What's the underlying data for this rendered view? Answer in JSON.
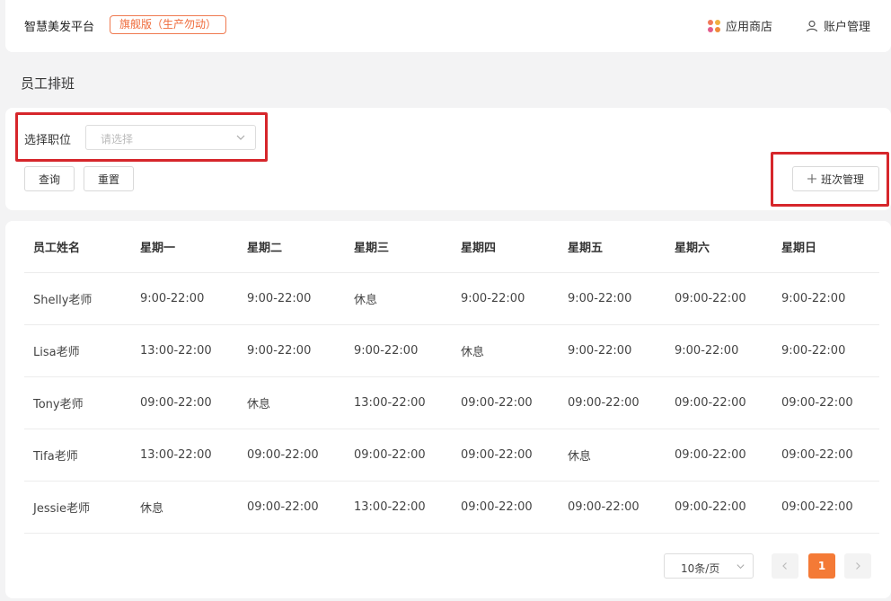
{
  "header": {
    "brand": "智慧美发平台",
    "edition": "旗舰版（生产勿动）",
    "app_store": "应用商店",
    "account": "账户管理",
    "app_store_icon_colors": [
      "#f07a5a",
      "#f0b040",
      "#e25b8c",
      "#f08a3a"
    ]
  },
  "page": {
    "title": "员工排班"
  },
  "filter": {
    "position_label": "选择职位",
    "position_placeholder": "请选择",
    "query_label": "查询",
    "reset_label": "重置",
    "shift_manage_label": "班次管理",
    "shift_manage_icon": "plus-icon"
  },
  "table": {
    "columns": [
      "员工姓名",
      "星期一",
      "星期二",
      "星期三",
      "星期四",
      "星期五",
      "星期六",
      "星期日"
    ],
    "rows": [
      [
        "Shelly老师",
        "9:00-22:00",
        "9:00-22:00",
        "休息",
        "9:00-22:00",
        "9:00-22:00",
        "09:00-22:00",
        "9:00-22:00"
      ],
      [
        "Lisa老师",
        "13:00-22:00",
        "9:00-22:00",
        "9:00-22:00",
        "休息",
        "9:00-22:00",
        "9:00-22:00",
        "9:00-22:00"
      ],
      [
        "Tony老师",
        "09:00-22:00",
        "休息",
        "13:00-22:00",
        "09:00-22:00",
        "09:00-22:00",
        "09:00-22:00",
        "09:00-22:00"
      ],
      [
        "Tifa老师",
        "13:00-22:00",
        "09:00-22:00",
        "09:00-22:00",
        "09:00-22:00",
        "休息",
        "09:00-22:00",
        "09:00-22:00"
      ],
      [
        "Jessie老师",
        "休息",
        "09:00-22:00",
        "13:00-22:00",
        "09:00-22:00",
        "09:00-22:00",
        "09:00-22:00",
        "09:00-22:00"
      ]
    ]
  },
  "pagination": {
    "page_size": "10条/页",
    "current_page": "1",
    "accent_color": "#f47a36"
  },
  "highlight_color": "#d6262b"
}
